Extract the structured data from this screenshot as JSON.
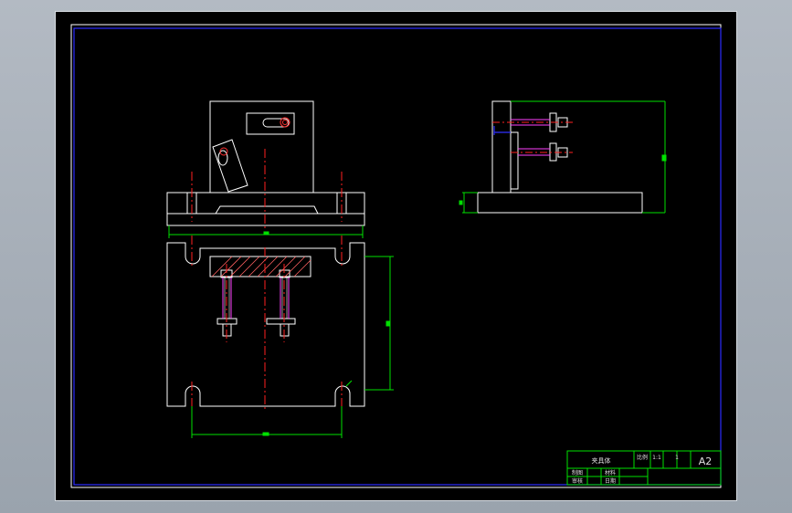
{
  "title_block": {
    "part_name": "夹具体",
    "scale_label": "比例",
    "scale_value": "1:1",
    "sheet_no": "1",
    "sheet_size": "A2",
    "drawn_by_label": "制图",
    "checked_by_label": "审核",
    "material_label": "材料",
    "date_label": "日期"
  },
  "colors": {
    "background": "#000000",
    "outline": "#ffffff",
    "dimension": "#00ff00",
    "centerline": "#ff0000",
    "frame": "#0000ff",
    "hatch": "#ff6060",
    "bolt": "#ff00ff"
  }
}
